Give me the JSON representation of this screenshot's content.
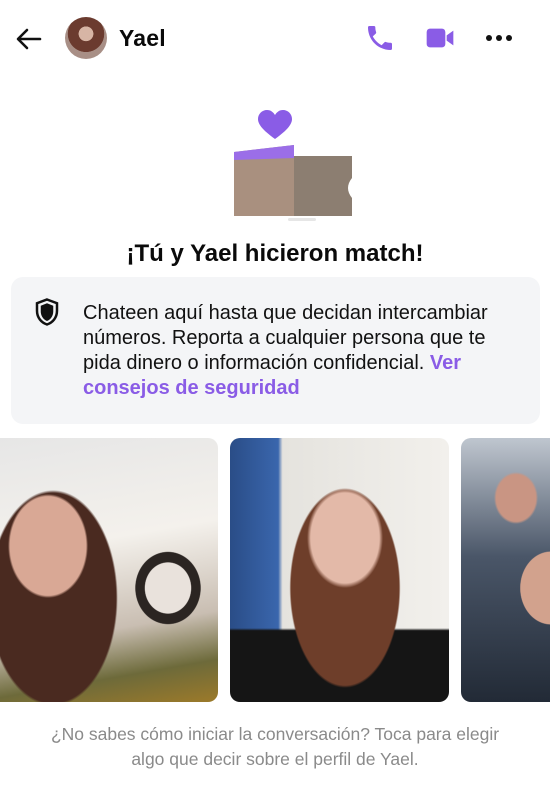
{
  "header": {
    "contact_name": "Yael",
    "back_icon": "arrow-left-icon",
    "call_icon": "phone-icon",
    "video_icon": "video-camera-icon",
    "more_icon": "more-horizontal-icon",
    "accent_color": "#8a5ce6"
  },
  "match": {
    "title": "¡Tú y Yael hicieron match!",
    "heart_icon": "heart-icon"
  },
  "safety": {
    "icon": "shield-icon",
    "text": "Chateen aquí hasta que decidan intercambiar números. Reporta a cualquier persona que te pida dinero o información confidencial.",
    "link": "Ver consejos de seguridad"
  },
  "photos": [
    {
      "label": "photo-1"
    },
    {
      "label": "photo-2"
    },
    {
      "label": "photo-3"
    }
  ],
  "hint": {
    "text": "¿No sabes cómo iniciar la conversación? Toca para elegir algo que decir sobre el perfil de Yael."
  }
}
